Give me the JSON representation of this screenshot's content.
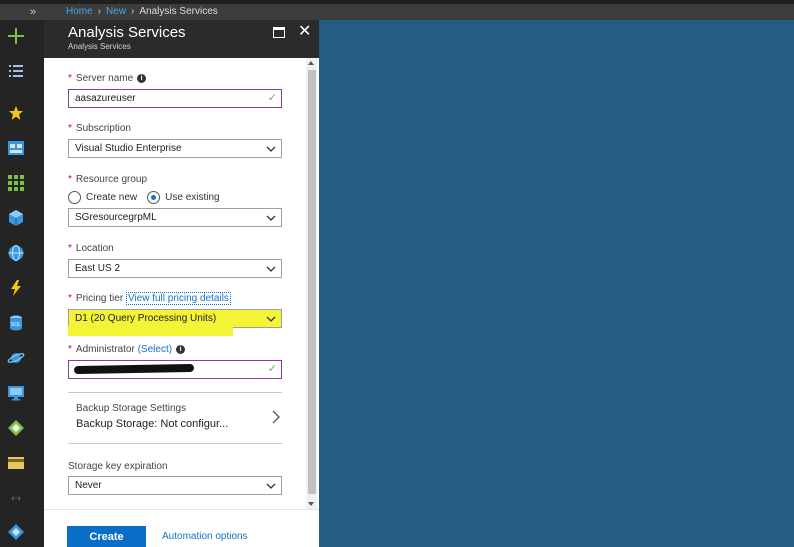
{
  "breadcrumb": {
    "home": "Home",
    "new": "New",
    "current": "Analysis Services",
    "separator": "›"
  },
  "topbar": {
    "expand_glyph": "»"
  },
  "rail": {
    "items": [
      "add-icon",
      "list-icon",
      "favorites-icon",
      "dashboard-icon",
      "all-resources-icon",
      "cube-icon",
      "globe-icon",
      "function-icon",
      "sql-icon",
      "planet-icon",
      "monitor-icon",
      "diamond-icon",
      "card-icon",
      "network-icon",
      "diamond2-icon"
    ]
  },
  "blade": {
    "title": "Analysis Services",
    "subtitle": "Analysis Services",
    "close_glyph": "✕"
  },
  "form": {
    "required_mark": "*",
    "server_name": {
      "label": "Server name",
      "info": "i",
      "value": "aasazureuser",
      "valid_glyph": "✓"
    },
    "subscription": {
      "label": "Subscription",
      "value": "Visual Studio Enterprise"
    },
    "resource_group": {
      "label": "Resource group",
      "option_new": "Create new",
      "option_existing": "Use existing",
      "selected": "existing",
      "value": "SGresourcegrpML"
    },
    "location": {
      "label": "Location",
      "value": "East US 2"
    },
    "pricing_tier": {
      "label": "Pricing tier",
      "link": "View full pricing details",
      "value": "D1 (20 Query Processing Units)"
    },
    "administrator": {
      "label": "Administrator",
      "link": "(Select)",
      "info": "i",
      "valid_glyph": "✓"
    },
    "backup": {
      "title": "Backup Storage Settings",
      "value": "Backup Storage: Not configur..."
    },
    "storage_key": {
      "label": "Storage key expiration",
      "value": "Never"
    }
  },
  "footer": {
    "create": "Create",
    "automation": "Automation options"
  },
  "colors": {
    "accent": "#0b6ec6",
    "highlight": "#f4f437",
    "background": "#245c82",
    "valid": "#5cb85c"
  }
}
